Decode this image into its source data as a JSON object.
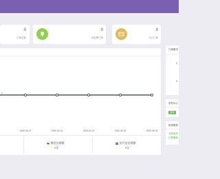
{
  "stats": [
    {
      "value": "0",
      "label": "订单总数"
    },
    {
      "value": "0",
      "label": "待处理订单"
    },
    {
      "value": "0",
      "label": "今日订单"
    }
  ],
  "chart_data": {
    "type": "line",
    "x": [
      "2020-06-12",
      "2020-06-13",
      "2020-06-14",
      "2020-06-15",
      "2020-06-16"
    ],
    "y_visible_left": "0",
    "series": [
      {
        "values": [
          0,
          0,
          0,
          0,
          0
        ]
      }
    ],
    "color": "#2e3b34"
  },
  "summary": [
    {
      "icon": "wechat-icon",
      "label": "微信交易额",
      "value": "0元"
    },
    {
      "icon": "card-icon",
      "label": "支付宝交易额",
      "value": "0元"
    }
  ],
  "side": {
    "panel1_title": "订单概况",
    "panel1_values": [
      "0",
      "0"
    ],
    "panel2_title": "发布中心",
    "panel2_button": "发布",
    "panel3_title": "检测更新",
    "panel3_lines": [
      "当前版本",
      "已是最新"
    ]
  },
  "colors": {
    "topbar": "#7a5fb3",
    "icon_blue": "#4a8fd0",
    "icon_green": "#8fd14f",
    "icon_gold": "#e0b95f",
    "wechat": "#2d8c2d",
    "card": "#5a3f9e"
  }
}
